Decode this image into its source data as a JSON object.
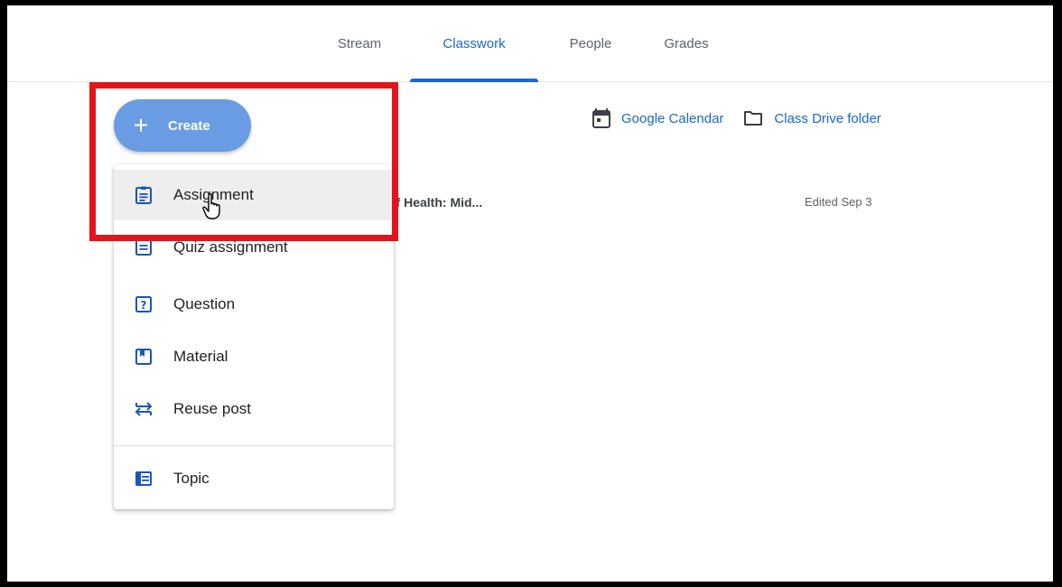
{
  "tabs": [
    {
      "label": "Stream",
      "active": false
    },
    {
      "label": "Classwork",
      "active": true
    },
    {
      "label": "People",
      "active": false
    },
    {
      "label": "Grades",
      "active": false
    }
  ],
  "links": {
    "calendar": {
      "label": "Google Calendar",
      "icon": "calendar-icon"
    },
    "drive": {
      "label": "Class Drive folder",
      "icon": "folder-icon"
    }
  },
  "create_button": {
    "label": "Create",
    "icon": "plus-icon"
  },
  "menu": {
    "items": [
      {
        "label": "Assignment",
        "icon": "assignment-icon"
      },
      {
        "label": "Quiz assignment",
        "icon": "quiz-icon"
      },
      {
        "label": "Question",
        "icon": "question-icon"
      },
      {
        "label": "Material",
        "icon": "material-icon"
      },
      {
        "label": "Reuse post",
        "icon": "reuse-icon"
      },
      {
        "label": "Topic",
        "icon": "topic-icon"
      }
    ],
    "hovered_index": 0
  },
  "background_item": {
    "title": "of Health: Mid...",
    "edited": "Edited Sep 3"
  },
  "colors": {
    "accent": "#1967d2",
    "create_button": "#6a9ce4",
    "highlight": "#e5141a"
  }
}
